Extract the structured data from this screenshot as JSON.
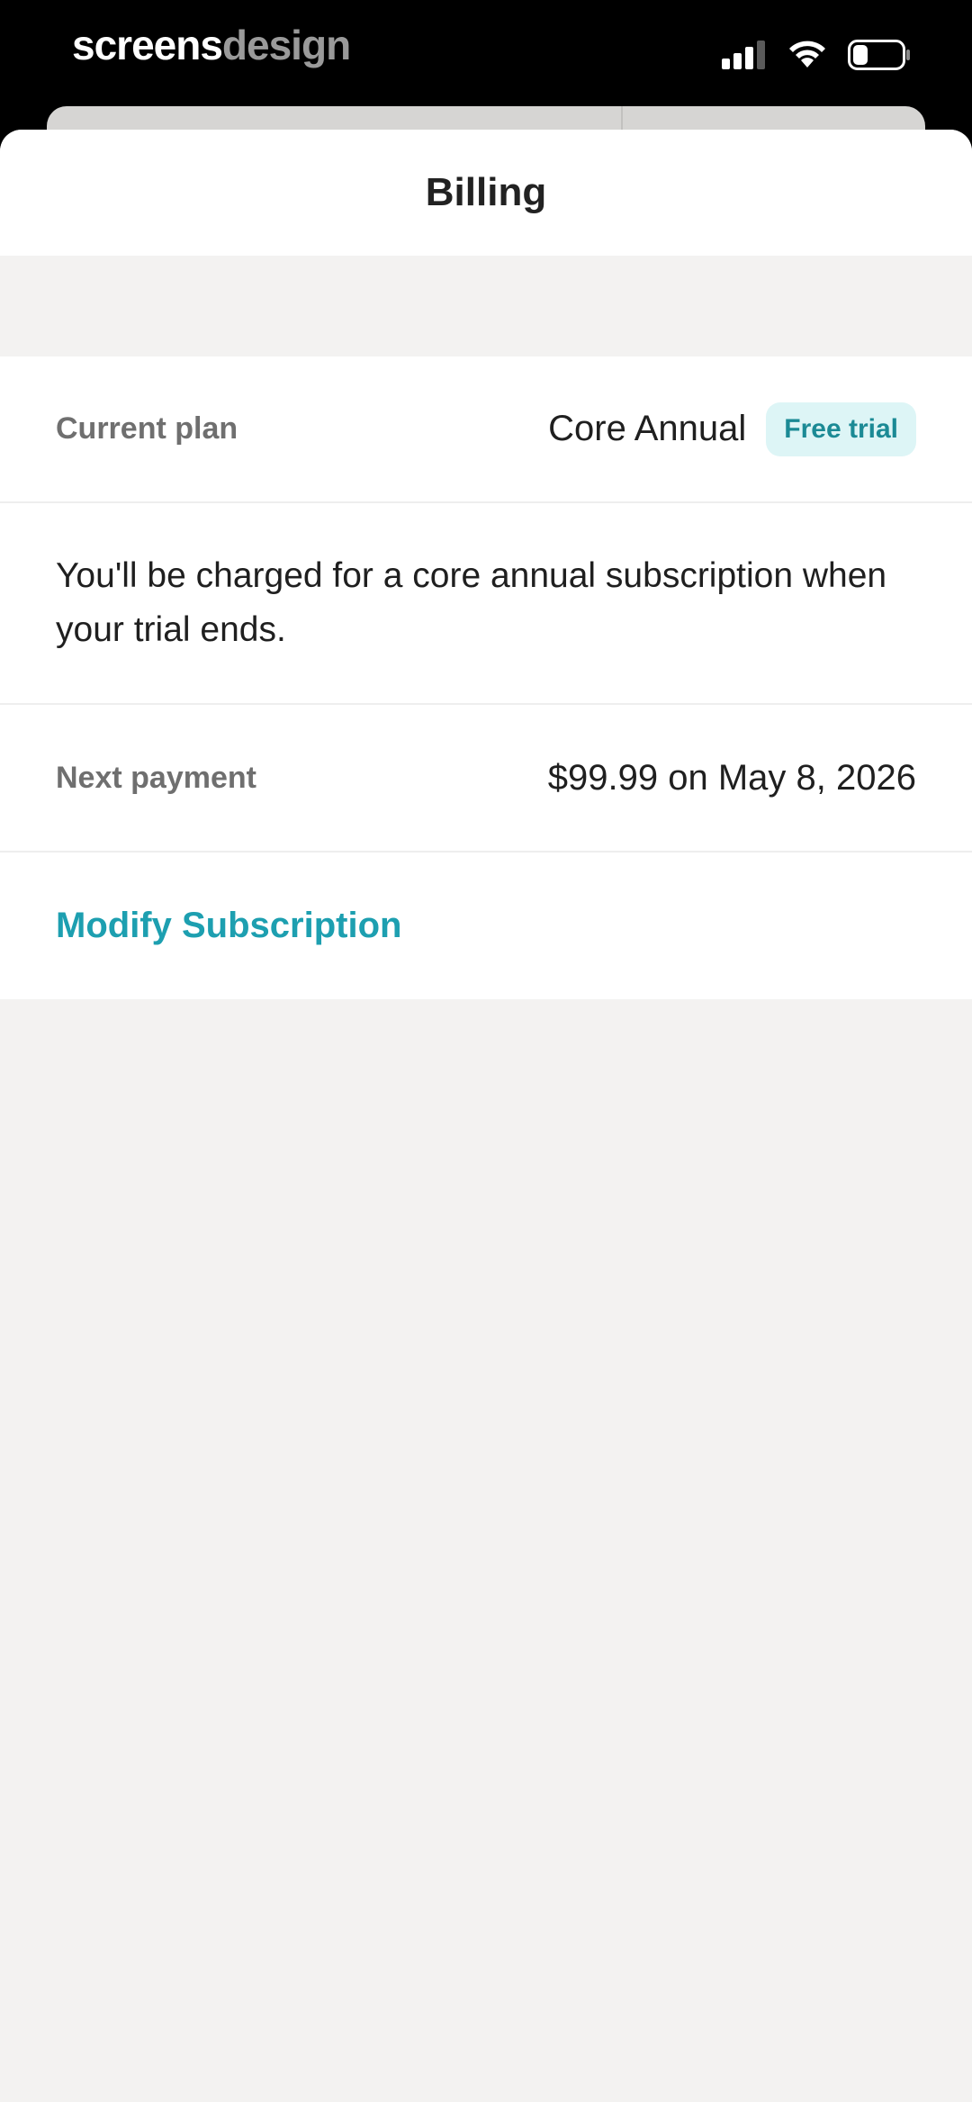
{
  "status_bar": {
    "brand_part1": "screens",
    "brand_part2": "design"
  },
  "header": {
    "title": "Billing"
  },
  "plan": {
    "label": "Current plan",
    "name": "Core Annual",
    "badge": "Free trial"
  },
  "notice": {
    "text": "You'll be charged for a core annual subscription when your trial ends."
  },
  "payment": {
    "label": "Next payment",
    "value": "$99.99 on May 8, 2026"
  },
  "actions": {
    "modify_label": "Modify Subscription"
  },
  "colors": {
    "accent": "#1d9fb0",
    "badge_bg": "#ddf5f6",
    "badge_text": "#1b8a95",
    "page_bg": "#f3f2f1"
  },
  "icons": {
    "signal": "cellular-signal-icon",
    "wifi": "wifi-icon",
    "battery": "battery-icon"
  }
}
